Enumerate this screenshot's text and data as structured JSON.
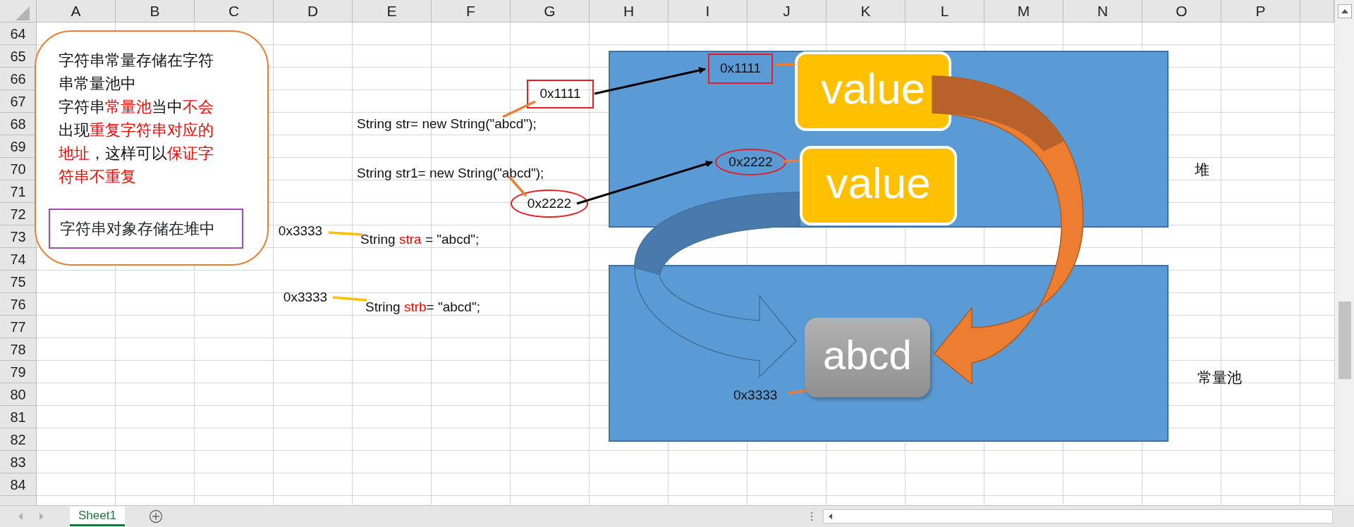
{
  "sheet": {
    "columns": [
      "A",
      "B",
      "C",
      "D",
      "E",
      "F",
      "G",
      "H",
      "I",
      "J",
      "K",
      "L",
      "M",
      "N",
      "O",
      "P"
    ],
    "rows": [
      "64",
      "65",
      "66",
      "67",
      "68",
      "69",
      "70",
      "71",
      "72",
      "73",
      "74",
      "75",
      "76",
      "77",
      "78",
      "79",
      "80",
      "81",
      "82",
      "83",
      "84"
    ]
  },
  "note": {
    "lines": [
      [
        {
          "text": "字符串常量存储在字符",
          "highlight": false
        }
      ],
      [
        {
          "text": "串常量池中",
          "highlight": false
        }
      ],
      [
        {
          "text": "字符串",
          "highlight": false
        },
        {
          "text": "常量池",
          "highlight": true
        },
        {
          "text": "当中",
          "highlight": false
        },
        {
          "text": "不会",
          "highlight": true
        }
      ],
      [
        {
          "text": "出现",
          "highlight": false
        },
        {
          "text": "重复字符串对应的",
          "highlight": true
        }
      ],
      [
        {
          "text": "地址",
          "highlight": true
        },
        {
          "text": "，这样可以",
          "highlight": false
        },
        {
          "text": "保证字",
          "highlight": true
        }
      ],
      [
        {
          "text": "符串不重复",
          "highlight": true
        }
      ]
    ],
    "boxed_text": "字符串对象存储在堆中"
  },
  "statements": [
    {
      "parts": [
        {
          "text": "String str= new String(\"abcd\");",
          "highlight": false
        }
      ],
      "address": "0x1111",
      "kind": "boxed"
    },
    {
      "parts": [
        {
          "text": "String str1= new String(\"abcd\");",
          "highlight": false
        }
      ],
      "address": "0x2222",
      "kind": "circled"
    },
    {
      "parts": [
        {
          "text": "String ",
          "highlight": false
        },
        {
          "text": "stra",
          "highlight": true
        },
        {
          "text": " = \"abcd\";",
          "highlight": false
        }
      ],
      "address": "0x3333",
      "kind": "plain"
    },
    {
      "parts": [
        {
          "text": "String ",
          "highlight": false
        },
        {
          "text": "strb",
          "highlight": true
        },
        {
          "text": "= \"abcd\";",
          "highlight": false
        }
      ],
      "address": "0x3333",
      "kind": "plain"
    }
  ],
  "heap": {
    "label": "堆",
    "objects": [
      {
        "address": "0x1111",
        "kind": "boxed",
        "value": "value"
      },
      {
        "address": "0x2222",
        "kind": "circled",
        "value": "value"
      }
    ]
  },
  "pool": {
    "label": "常量池",
    "address": "0x3333",
    "value": "abcd"
  },
  "sheet_tabs": [
    {
      "label": "Sheet1",
      "selected": true
    }
  ]
}
